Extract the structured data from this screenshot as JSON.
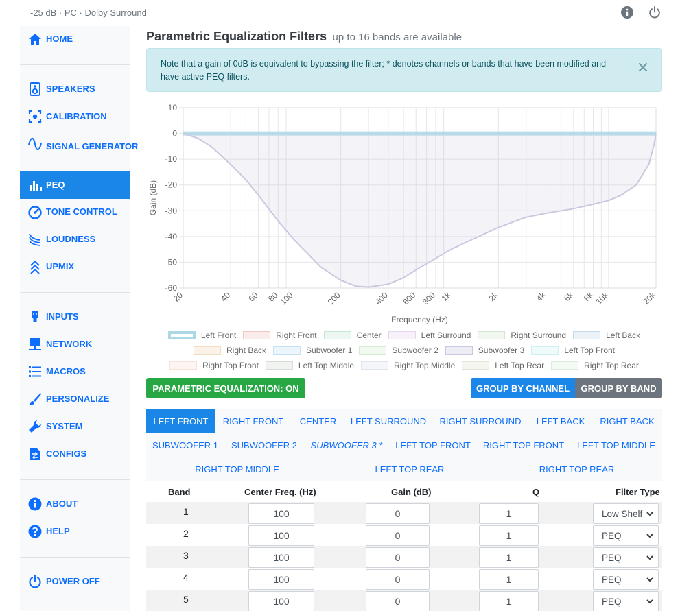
{
  "topbar": {
    "status": "-25 dB · PC · Dolby Surround",
    "info_icon": "info-circle-icon",
    "power_icon": "power-icon"
  },
  "sidebar": {
    "items": [
      {
        "label": "HOME",
        "icon": "home-icon"
      },
      {
        "label": "SPEAKERS",
        "icon": "speaker-icon"
      },
      {
        "label": "CALIBRATION",
        "icon": "calibration-icon"
      },
      {
        "label": "SIGNAL GENERATOR",
        "icon": "sine-wave-icon"
      },
      {
        "label": "PEQ",
        "icon": "bar-chart-icon",
        "active": true
      },
      {
        "label": "TONE CONTROL",
        "icon": "gauge-icon"
      },
      {
        "label": "LOUDNESS",
        "icon": "loudness-icon"
      },
      {
        "label": "UPMIX",
        "icon": "upmix-icon"
      },
      {
        "label": "INPUTS",
        "icon": "plug-icon"
      },
      {
        "label": "NETWORK",
        "icon": "network-icon"
      },
      {
        "label": "MACROS",
        "icon": "list-icon"
      },
      {
        "label": "PERSONALIZE",
        "icon": "brush-icon"
      },
      {
        "label": "SYSTEM",
        "icon": "wrench-icon"
      },
      {
        "label": "CONFIGS",
        "icon": "file-transfer-icon"
      },
      {
        "label": "ABOUT",
        "icon": "info-icon"
      },
      {
        "label": "HELP",
        "icon": "question-icon"
      },
      {
        "label": "POWER OFF",
        "icon": "power-icon"
      }
    ]
  },
  "header": {
    "title": "Parametric Equalization Filters",
    "subtitle": "up to 16 bands are available"
  },
  "alert": {
    "text": "Note that a gain of 0dB is equivalent to bypassing the filter; * denotes channels or bands that have been modified and have active PEQ filters."
  },
  "chart_data": {
    "type": "line",
    "xlabel": "Frequency (Hz)",
    "ylabel": "Gain (dB)",
    "x_scale": "log",
    "xlim": [
      20,
      20000
    ],
    "ylim": [
      -60,
      10
    ],
    "x_ticks": [
      "20",
      "40",
      "60",
      "80",
      "100",
      "200",
      "400",
      "600",
      "800",
      "1k",
      "2k",
      "4k",
      "6k",
      "8k",
      "10k",
      "20k"
    ],
    "y_ticks": [
      "10",
      "0",
      "-10",
      "-20",
      "-30",
      "-40",
      "-50",
      "-60"
    ],
    "grid": true,
    "series": [
      {
        "name": "Left Front",
        "color": "#add8e6",
        "x": [
          20,
          20000
        ],
        "y": [
          0,
          0
        ]
      },
      {
        "name": "Subwoofer 3",
        "color": "#c8c8e0",
        "fill": true,
        "x": [
          20,
          25,
          30,
          40,
          50,
          60,
          80,
          100,
          150,
          200,
          250,
          300,
          400,
          500,
          600,
          800,
          1000,
          1500,
          2000,
          3000,
          4000,
          5000,
          6000,
          8000,
          10000,
          12000,
          15000,
          18000,
          19500,
          20000
        ],
        "y": [
          0,
          -2,
          -5,
          -12,
          -18,
          -24,
          -34,
          -41,
          -52,
          -57,
          -59.3,
          -59.6,
          -58.5,
          -56,
          -53,
          -48.5,
          -45,
          -40,
          -36.5,
          -32.5,
          -31,
          -30,
          -29.2,
          -27.5,
          -26,
          -24,
          -20,
          -12,
          -4,
          0
        ]
      }
    ],
    "legend_position": "bottom"
  },
  "legend": {
    "rows": [
      [
        {
          "label": "Left Front",
          "color": "#add8e6",
          "active": true
        },
        {
          "label": "Right Front",
          "color": "#f4c6c6"
        },
        {
          "label": "Center",
          "color": "#c6e8d8"
        },
        {
          "label": "Left Surround",
          "color": "#e6d6ee"
        },
        {
          "label": "Right Surround",
          "color": "#d6e6d0"
        },
        {
          "label": "Left Back",
          "color": "#c2daea"
        }
      ],
      [
        {
          "label": "Right Back",
          "color": "#f3dcc0"
        },
        {
          "label": "Subwoofer 1",
          "color": "#c6e0f4"
        },
        {
          "label": "Subwoofer 2",
          "color": "#d6ecd2"
        },
        {
          "label": "Subwoofer 3",
          "color": "#c8c8e0"
        },
        {
          "label": "Left Top Front",
          "color": "#d0f0f4"
        }
      ],
      [
        {
          "label": "Right Top Front",
          "color": "#f6e2d8"
        },
        {
          "label": "Left Top Middle",
          "color": "#d6dcd6"
        },
        {
          "label": "Right Top Middle",
          "color": "#dfe4ee"
        },
        {
          "label": "Left Top Rear",
          "color": "#e4e4d6"
        },
        {
          "label": "Right Top Rear",
          "color": "#dcecdc"
        }
      ]
    ]
  },
  "controls": {
    "peq_toggle": "PARAMETRIC EQUALIZATION: ON",
    "group_by_channel": "GROUP BY CHANNEL",
    "group_by_band": "GROUP BY BAND"
  },
  "tabs": [
    {
      "label": "LEFT FRONT",
      "active": true
    },
    {
      "label": "RIGHT FRONT"
    },
    {
      "label": "CENTER"
    },
    {
      "label": "LEFT SURROUND"
    },
    {
      "label": "RIGHT SURROUND"
    },
    {
      "label": "LEFT BACK"
    },
    {
      "label": "RIGHT BACK"
    },
    {
      "label": "SUBWOOFER 1"
    },
    {
      "label": "SUBWOOFER 2"
    },
    {
      "label": "SUBWOOFER 3 *",
      "modified": true
    },
    {
      "label": "LEFT TOP FRONT"
    },
    {
      "label": "RIGHT TOP FRONT"
    },
    {
      "label": "LEFT TOP MIDDLE"
    },
    {
      "label": "RIGHT TOP MIDDLE"
    },
    {
      "label": "LEFT TOP REAR"
    },
    {
      "label": "RIGHT TOP REAR"
    }
  ],
  "table": {
    "headers": [
      "Band",
      "Center Freq. (Hz)",
      "Gain (dB)",
      "Q",
      "Filter Type"
    ],
    "rows": [
      {
        "band": "1",
        "freq": "100",
        "gain": "0",
        "q": "1",
        "type": "Low Shelf"
      },
      {
        "band": "2",
        "freq": "100",
        "gain": "0",
        "q": "1",
        "type": "PEQ"
      },
      {
        "band": "3",
        "freq": "100",
        "gain": "0",
        "q": "1",
        "type": "PEQ"
      },
      {
        "band": "4",
        "freq": "100",
        "gain": "0",
        "q": "1",
        "type": "PEQ"
      },
      {
        "band": "5",
        "freq": "100",
        "gain": "0",
        "q": "1",
        "type": "PEQ"
      }
    ]
  }
}
